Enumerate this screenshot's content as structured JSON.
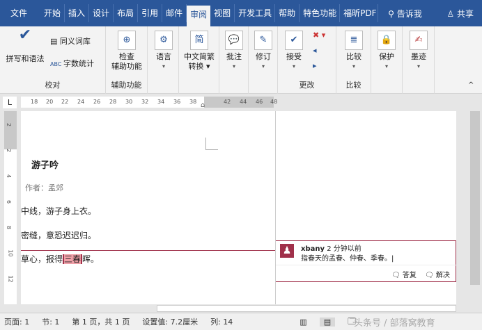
{
  "tabs": [
    "文件",
    "开始",
    "插入",
    "设计",
    "布局",
    "引用",
    "邮件",
    "审阅",
    "视图",
    "开发工具",
    "帮助",
    "特色功能",
    "福昕PDF"
  ],
  "active_tab": "审阅",
  "tell_me": "告诉我",
  "share": "共享",
  "ribbon": {
    "spelling": "拼写和语法",
    "thesaurus": "同义词库",
    "word_count": "字数统计",
    "proofing": "校对",
    "check_access_1": "检查",
    "check_access_2": "辅助功能",
    "accessibility": "辅助功能",
    "language": "语言",
    "convert_1": "中文简繁",
    "convert_2": "转换",
    "comment": "批注",
    "track": "修订",
    "accept": "接受",
    "changes": "更改",
    "compare": "比较",
    "compare_group": "比较",
    "protect": "保护",
    "ink": "墨迹"
  },
  "ruler": [
    "18",
    "20",
    "22",
    "24",
    "26",
    "28",
    "30",
    "32",
    "34",
    "36",
    "38",
    "42",
    "44",
    "46",
    "48"
  ],
  "vruler": [
    "2",
    "2",
    "4",
    "6",
    "8",
    "10",
    "12"
  ],
  "doc": {
    "title": "游子吟",
    "author": "作者：孟郊",
    "line1": "中线，游子身上衣。",
    "line2": "密缝，意恐迟迟归。",
    "line3a": "草心，报得",
    "line3b": "三春",
    "line3c": "晖。"
  },
  "comment": {
    "user": "xbany",
    "time": "2 分钟以前",
    "text": "指春天的孟春、仲春、季春。",
    "reply": "答复",
    "resolve": "解决"
  },
  "status": {
    "page": "页面: 1",
    "section": "节: 1",
    "pages": "第 1 页，共 1 页",
    "setting": "设置值: 7.2厘米",
    "col": "列: 14"
  },
  "watermark": "头条号 / 部落窝教育"
}
